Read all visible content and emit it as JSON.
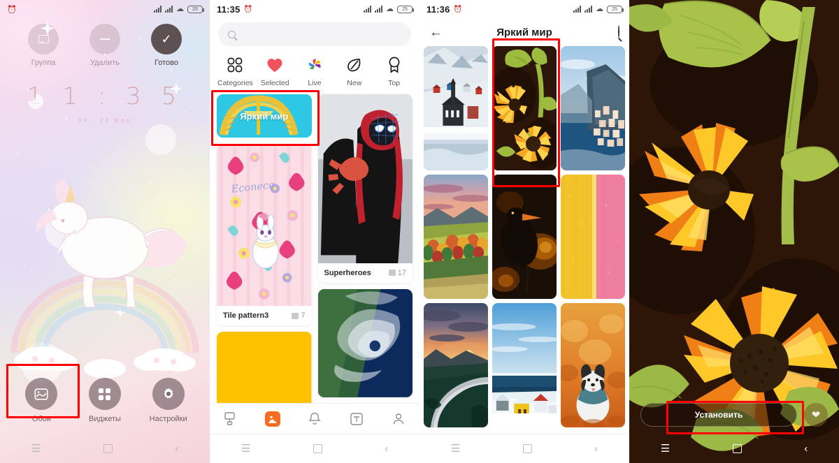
{
  "panels": [
    {
      "id": "home-edit-mode",
      "statusbar": {
        "time": "",
        "alarm_icon": "alarm-icon",
        "signal_icon": "signal-bars-icon",
        "wifi_icon": "wifi-icon",
        "battery": "25"
      },
      "actions": [
        {
          "label": "Группа",
          "icon": "group-square-icon",
          "enabled": false
        },
        {
          "label": "Удалить",
          "icon": "minus-icon",
          "enabled": false
        },
        {
          "label": "Готово",
          "icon": "check-icon",
          "enabled": true
        }
      ],
      "clock": {
        "time": "1 1 : 3 5",
        "date": "05 · 22  Mon"
      },
      "dock": [
        {
          "label": "Обои",
          "icon": "wallpaper-icon",
          "highlighted": true
        },
        {
          "label": "Виджеты",
          "icon": "widgets-icon",
          "highlighted": false
        },
        {
          "label": "Настройки",
          "icon": "settings-gear-icon",
          "highlighted": false
        }
      ]
    },
    {
      "id": "wallpaper-app-home",
      "statusbar": {
        "time": "11:35",
        "battery": "25"
      },
      "search": {
        "placeholder": "",
        "value": "",
        "icon": "search-icon"
      },
      "categories": [
        {
          "label": "Categories",
          "icon": "four-squares-icon"
        },
        {
          "label": "Selected",
          "icon": "heart-icon"
        },
        {
          "label": "Live",
          "icon": "pinwheel-icon"
        },
        {
          "label": "New",
          "icon": "leaf-icon"
        },
        {
          "label": "Top",
          "icon": "ribbon-badge-icon"
        }
      ],
      "banner": {
        "title": "Яркий мир",
        "highlighted": true
      },
      "cards": [
        {
          "title": "Tile pattern3",
          "count": "7",
          "thumb": "floral-pattern"
        },
        {
          "title": "Superheroes",
          "count": "17",
          "thumb": "spiderman"
        },
        {
          "title": "",
          "count": "",
          "thumb": "yellow-block"
        },
        {
          "title": "",
          "count": "",
          "thumb": "hurricane-satellite"
        }
      ],
      "tabbar": [
        {
          "name": "wallpaper-tab",
          "icon": "wallpaper-roller-icon",
          "active": false
        },
        {
          "name": "themes-tab",
          "icon": "themes-icon",
          "active": true
        },
        {
          "name": "notifications-tab",
          "icon": "bell-icon",
          "active": false
        },
        {
          "name": "fonts-tab",
          "icon": "font-t-icon",
          "active": false
        },
        {
          "name": "profile-tab",
          "icon": "person-icon",
          "active": false
        }
      ]
    },
    {
      "id": "category-grid",
      "statusbar": {
        "time": "11:36",
        "battery": "25"
      },
      "header": {
        "back_icon": "back-arrow-icon",
        "title": "Яркий мир",
        "search_icon": "search-icon"
      },
      "wallpapers": [
        {
          "name": "snow-village",
          "selected": false
        },
        {
          "name": "sunflowers-dark",
          "selected": true
        },
        {
          "name": "positano-coast",
          "selected": false
        },
        {
          "name": "autumn-hills",
          "selected": false
        },
        {
          "name": "heron-bokeh",
          "selected": false
        },
        {
          "name": "yellow-pink-stripes",
          "selected": false
        },
        {
          "name": "mountain-road-sunset",
          "selected": false
        },
        {
          "name": "snow-houses-sea",
          "selected": false
        },
        {
          "name": "dog-autumn",
          "selected": false
        }
      ]
    },
    {
      "id": "wallpaper-preview",
      "statusbar": {
        "time": "",
        "battery": "25"
      },
      "wallpaper": "sunflowers-dark",
      "install_button": {
        "label": "Установить",
        "highlighted": true
      },
      "favorite_button": {
        "icon": "heart-icon"
      }
    }
  ],
  "navbar": {
    "menu_icon": "menu-icon",
    "home_icon": "home-square-icon",
    "back_icon": "back-chevron-icon"
  },
  "colors": {
    "highlight": "#ff0000",
    "accent_orange": "#f96c22",
    "banner_cyan": "#2fc8e4",
    "clock_pink": "#d6a7ac"
  }
}
